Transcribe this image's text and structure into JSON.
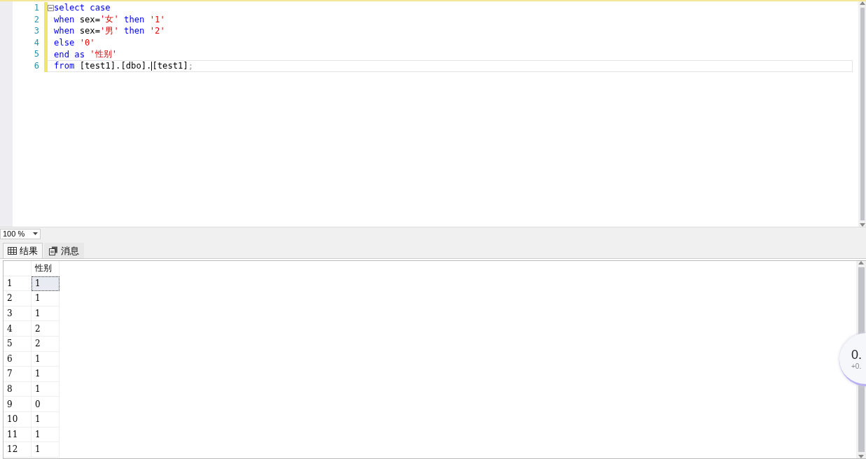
{
  "editor": {
    "lines": [
      {
        "number": "1",
        "foldable": true,
        "current": false,
        "tokens": [
          {
            "kind": "keyword",
            "text": "select case"
          }
        ]
      },
      {
        "number": "2",
        "foldable": false,
        "current": false,
        "tokens": [
          {
            "kind": "keyword",
            "text": "when"
          },
          {
            "kind": "plain",
            "text": " sex="
          },
          {
            "kind": "string",
            "text": "'女'"
          },
          {
            "kind": "keyword",
            "text": " then"
          },
          {
            "kind": "string",
            "text": " '1'"
          }
        ]
      },
      {
        "number": "3",
        "foldable": false,
        "current": false,
        "tokens": [
          {
            "kind": "keyword",
            "text": "when"
          },
          {
            "kind": "plain",
            "text": " sex="
          },
          {
            "kind": "string",
            "text": "'男'"
          },
          {
            "kind": "keyword",
            "text": " then"
          },
          {
            "kind": "string",
            "text": " '2'"
          }
        ]
      },
      {
        "number": "4",
        "foldable": false,
        "current": false,
        "tokens": [
          {
            "kind": "keyword",
            "text": "else"
          },
          {
            "kind": "string",
            "text": " '0'"
          }
        ]
      },
      {
        "number": "5",
        "foldable": false,
        "current": false,
        "tokens": [
          {
            "kind": "keyword",
            "text": "end"
          },
          {
            "kind": "keyword",
            "text": " as"
          },
          {
            "kind": "string",
            "text": " '性别'"
          }
        ]
      },
      {
        "number": "6",
        "foldable": false,
        "current": true,
        "tokens": [
          {
            "kind": "keyword",
            "text": "from"
          },
          {
            "kind": "plain",
            "text": " [test1].[dbo]."
          },
          {
            "kind": "cursor"
          },
          {
            "kind": "plain",
            "text": "[test1]"
          },
          {
            "kind": "punct",
            "text": ";"
          }
        ]
      }
    ]
  },
  "zoom": {
    "value": "100 %"
  },
  "tabs": [
    {
      "label": "结果",
      "selected": true
    },
    {
      "label": "消息",
      "selected": false
    }
  ],
  "results": {
    "columns": [
      "性别"
    ],
    "rows": [
      {
        "number": "1",
        "cells": [
          "1"
        ],
        "selected": true
      },
      {
        "number": "2",
        "cells": [
          "1"
        ],
        "selected": false
      },
      {
        "number": "3",
        "cells": [
          "1"
        ],
        "selected": false
      },
      {
        "number": "4",
        "cells": [
          "2"
        ],
        "selected": false
      },
      {
        "number": "5",
        "cells": [
          "2"
        ],
        "selected": false
      },
      {
        "number": "6",
        "cells": [
          "1"
        ],
        "selected": false
      },
      {
        "number": "7",
        "cells": [
          "1"
        ],
        "selected": false
      },
      {
        "number": "8",
        "cells": [
          "1"
        ],
        "selected": false
      },
      {
        "number": "9",
        "cells": [
          "0"
        ],
        "selected": false
      },
      {
        "number": "10",
        "cells": [
          "1"
        ],
        "selected": false
      },
      {
        "number": "11",
        "cells": [
          "1"
        ],
        "selected": false
      },
      {
        "number": "12",
        "cells": [
          "1"
        ],
        "selected": false
      }
    ]
  },
  "floating_widget": {
    "value": "0.",
    "change": "+0."
  }
}
